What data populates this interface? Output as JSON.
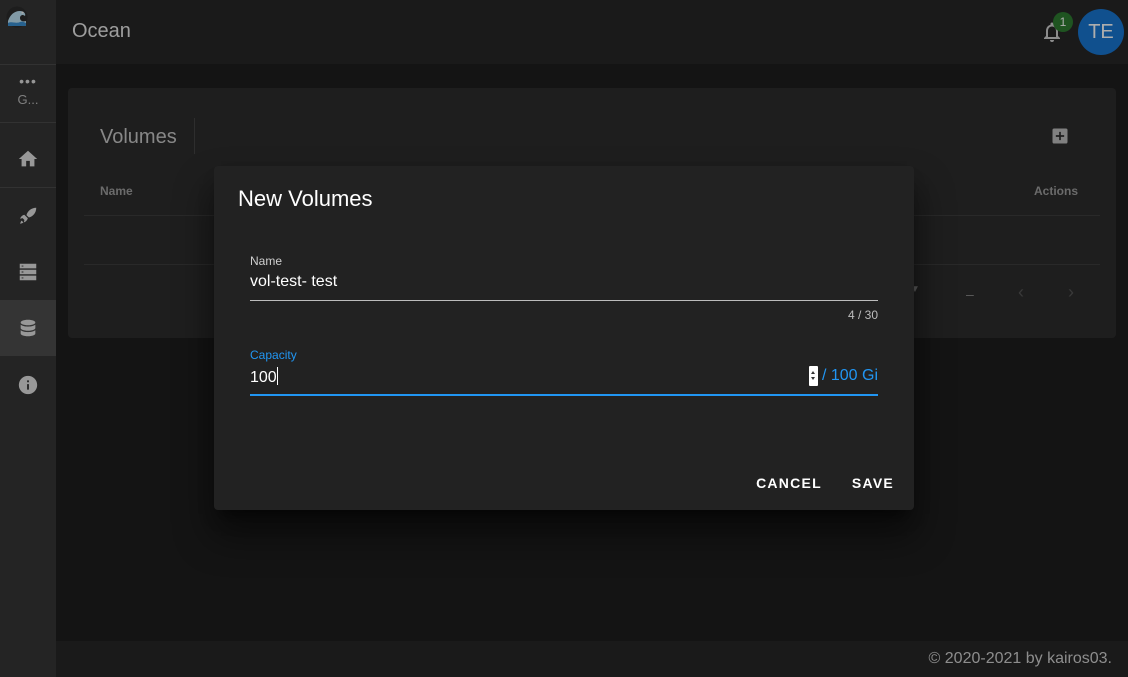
{
  "app": {
    "title": "Ocean"
  },
  "nav": {
    "more_label": "G...",
    "items": [
      {
        "icon": "home-icon"
      },
      {
        "icon": "rocket-icon"
      },
      {
        "icon": "server-icon"
      },
      {
        "icon": "database-icon",
        "active": true
      },
      {
        "icon": "info-icon"
      }
    ]
  },
  "header": {
    "notification_count": "1",
    "avatar_initials": "TE"
  },
  "page": {
    "title": "Volumes",
    "columns": {
      "name": "Name",
      "actions": "Actions"
    },
    "pagination_range": "–"
  },
  "dialog": {
    "title": "New Volumes",
    "name_field": {
      "label": "Name",
      "value": "vol-test- test",
      "counter": "4 / 30"
    },
    "capacity_field": {
      "label": "Capacity",
      "value": "100",
      "suffix": "/ 100 Gi"
    },
    "cancel_label": "CANCEL",
    "save_label": "SAVE"
  },
  "footer": {
    "copyright": "© 2020-2021 by kairos03."
  },
  "colors": {
    "accent": "#2196f3",
    "badge": "#2e7d32",
    "avatar": "#1976d2"
  }
}
